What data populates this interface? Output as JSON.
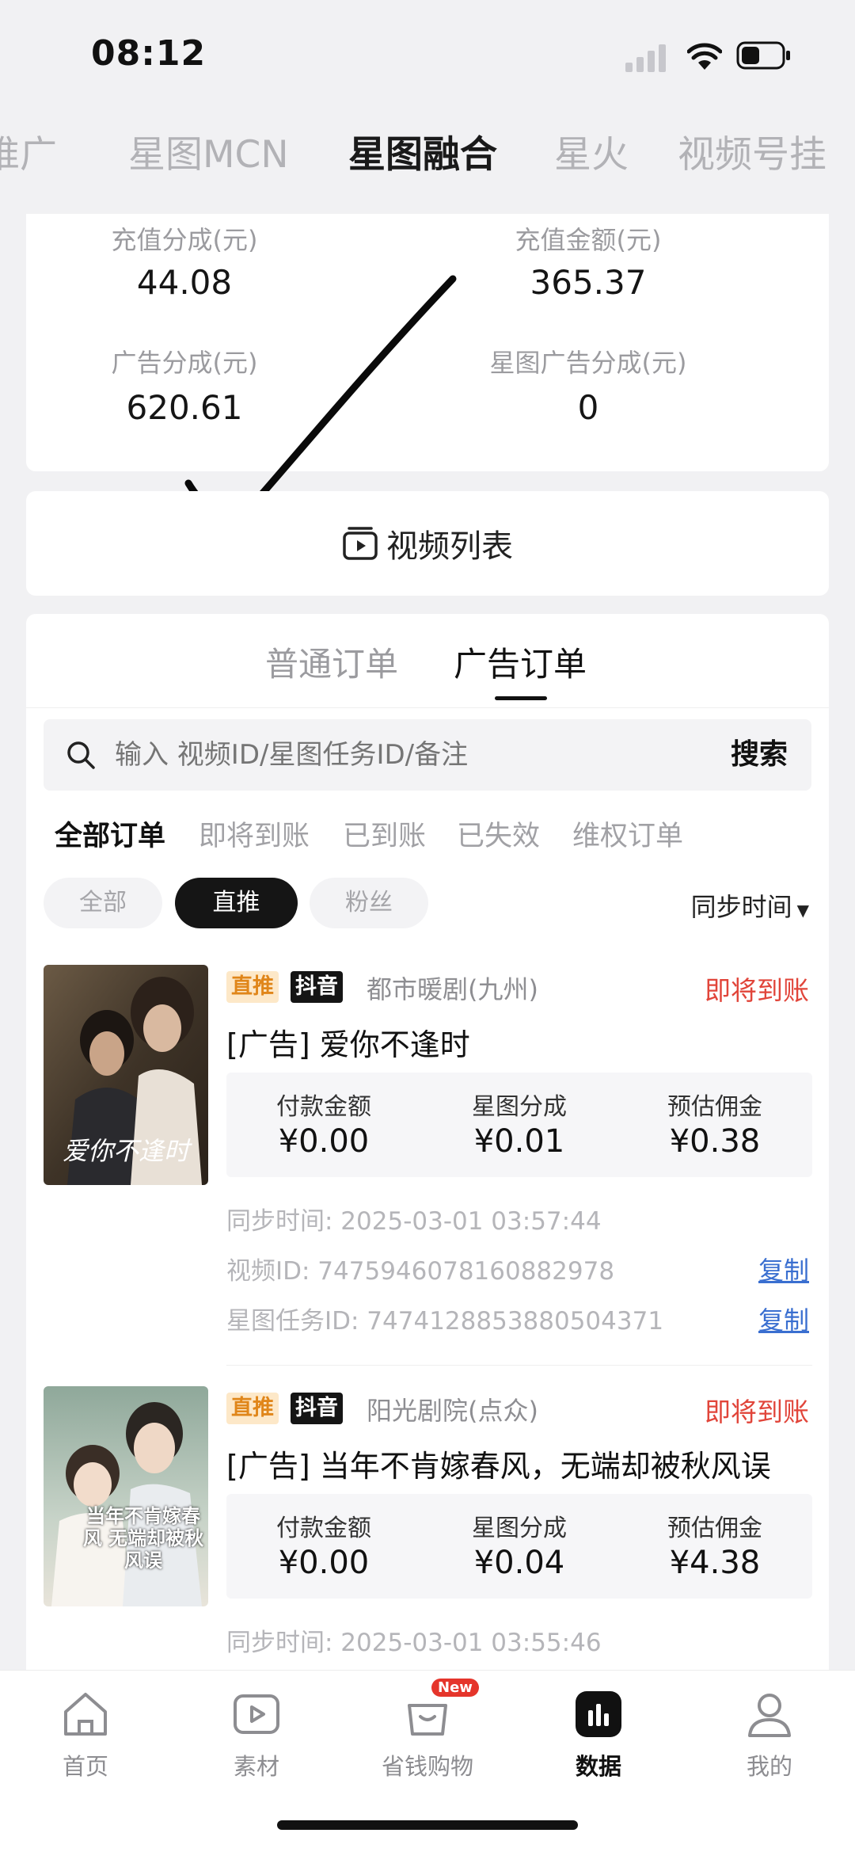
{
  "status_bar": {
    "time": "08:12"
  },
  "top_tabs": [
    "推广",
    "星图MCN",
    "星图融合",
    "星火",
    "视频号挂"
  ],
  "stats": [
    {
      "label": "充值分成(元)",
      "value": "44.08"
    },
    {
      "label": "充值金额(元)",
      "value": "365.37"
    },
    {
      "label": "广告分成(元)",
      "value": "620.61"
    },
    {
      "label": "星图广告分成(元)",
      "value": "0"
    }
  ],
  "video_list": {
    "label": "视频列表"
  },
  "order_tabs": [
    "普通订单",
    "广告订单"
  ],
  "search": {
    "placeholder": "输入 视频ID/星图任务ID/备注",
    "button": "搜索"
  },
  "filters": [
    "全部订单",
    "即将到账",
    "已到账",
    "已失效",
    "维权订单"
  ],
  "pills": [
    "全部",
    "直推",
    "粉丝"
  ],
  "sort": {
    "label": "同步时间"
  },
  "orders": [
    {
      "tag_type": "直推",
      "platform": "抖音",
      "channel": "都市暖剧(九州)",
      "status": "即将到账",
      "title": "[广告] 爱你不逢时",
      "amounts": [
        {
          "label": "付款金额",
          "value": "¥0.00"
        },
        {
          "label": "星图分成",
          "value": "¥0.01"
        },
        {
          "label": "预估佣金",
          "value": "¥0.38"
        }
      ],
      "sync_time": "同步时间: 2025-03-01 03:57:44",
      "video_id": "视频ID: 7475946078160882978",
      "task_id": "星图任务ID: 7474128853880504371",
      "copy_label": "复制",
      "poster_text": "爱你不逢时"
    },
    {
      "tag_type": "直推",
      "platform": "抖音",
      "channel": "阳光剧院(点众)",
      "status": "即将到账",
      "title": "[广告] 当年不肯嫁春风，无端却被秋风误",
      "amounts": [
        {
          "label": "付款金额",
          "value": "¥0.00"
        },
        {
          "label": "星图分成",
          "value": "¥0.04"
        },
        {
          "label": "预估佣金",
          "value": "¥4.38"
        }
      ],
      "sync_time": "同步时间: 2025-03-01 03:55:46",
      "poster_text": "当年不肯嫁春风 无端却被秋风误"
    }
  ],
  "bottom_nav": [
    {
      "label": "首页",
      "icon": "home-icon"
    },
    {
      "label": "素材",
      "icon": "play-icon"
    },
    {
      "label": "省钱购物",
      "icon": "shopping-bag-icon",
      "badge": "New"
    },
    {
      "label": "数据",
      "icon": "chart-icon"
    },
    {
      "label": "我的",
      "icon": "profile-icon"
    }
  ]
}
